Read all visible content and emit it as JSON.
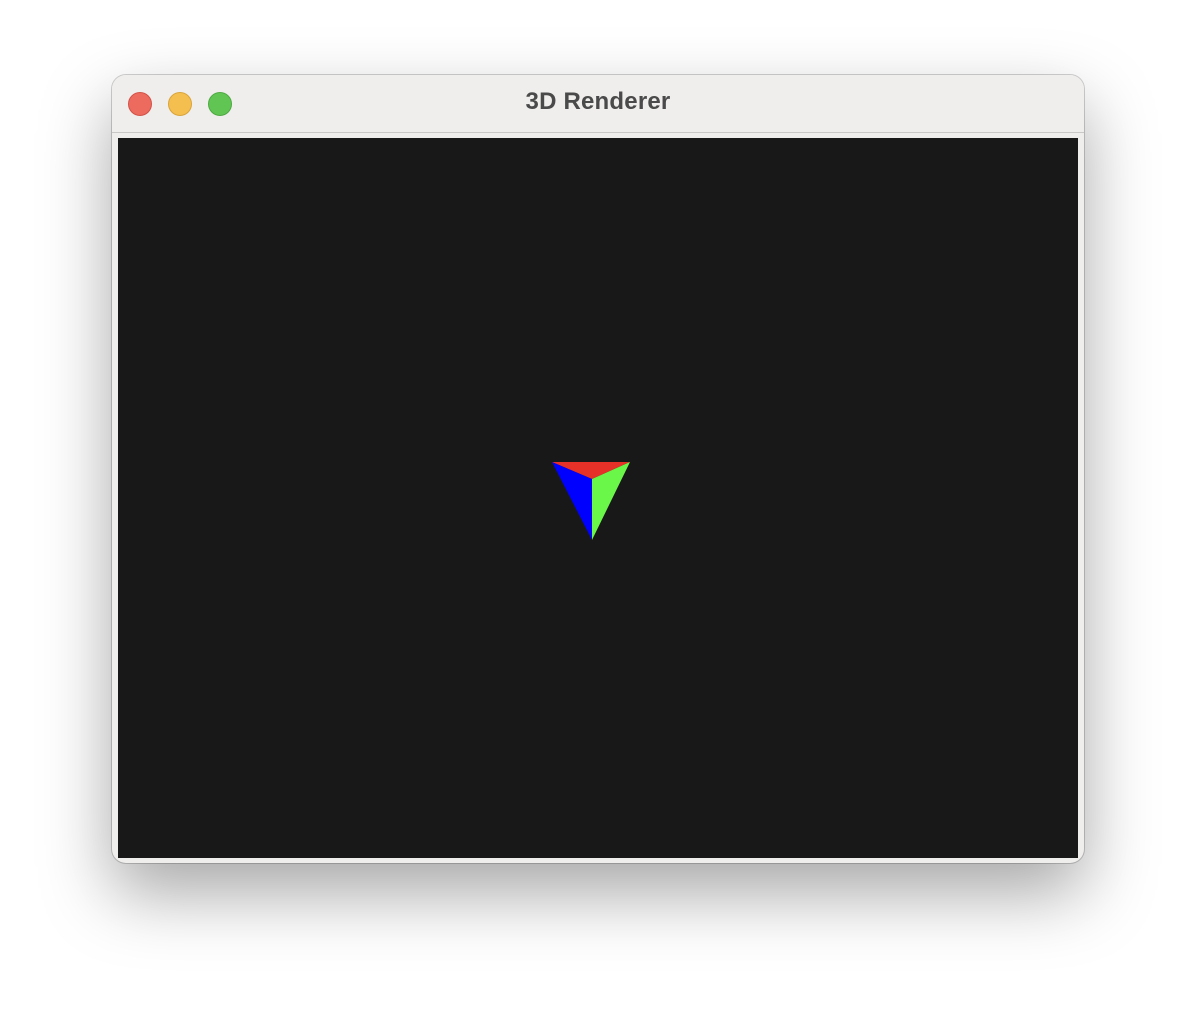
{
  "window": {
    "title": "3D Renderer"
  },
  "colors": {
    "background": "#181818",
    "face_top": "#e53127",
    "face_left": "#0000ff",
    "face_right": "#6af74a"
  },
  "icons": {
    "close": "close-icon",
    "minimize": "minimize-icon",
    "zoom": "zoom-icon"
  }
}
